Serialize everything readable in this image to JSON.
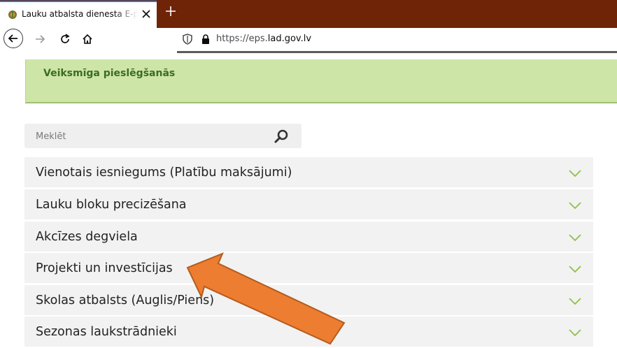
{
  "browser": {
    "tab_title": "Lauku atbalsta dienesta E-pieteikumu sistēma",
    "url_prefix": "https://eps.",
    "url_domain": "lad.gov.lv"
  },
  "alert": {
    "text": "Veiksmīga pieslēgšanās"
  },
  "search": {
    "placeholder": "Meklēt"
  },
  "accordion": [
    {
      "label": "Vienotais iesniegums (Platību maksājumi)"
    },
    {
      "label": "Lauku bloku precizēšana"
    },
    {
      "label": "Akcīzes degviela"
    },
    {
      "label": "Projekti un investīcijas"
    },
    {
      "label": "Skolas atbalsts (Auglis/Piens)"
    },
    {
      "label": "Sezonas laukstrādnieki"
    }
  ],
  "colors": {
    "tabbar": "#6f2408",
    "alert_bg": "#cde6a8",
    "alert_text": "#3c6c21",
    "chevron": "#8dc14a",
    "arrow_fill": "#ed7d31",
    "arrow_stroke": "#b35b1c"
  },
  "icons": [
    "crest-favicon-icon",
    "close-icon",
    "plus-icon",
    "back-arrow-icon",
    "forward-arrow-icon",
    "reload-icon",
    "home-icon",
    "shield-icon",
    "lock-icon",
    "search-icon",
    "chevron-down-icon"
  ]
}
